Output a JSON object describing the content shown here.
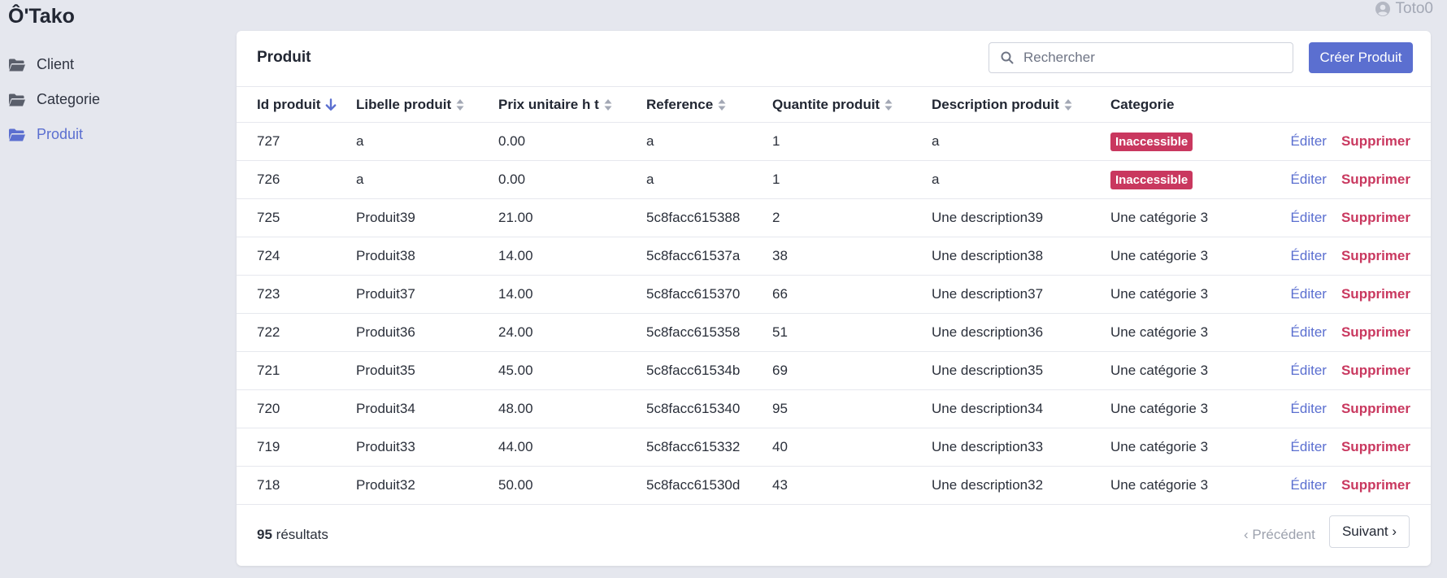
{
  "app": {
    "title": "Ô'Tako",
    "user": "Toto0"
  },
  "sidebar": {
    "items": [
      {
        "label": "Client",
        "icon": "folder-icon",
        "active": false
      },
      {
        "label": "Categorie",
        "icon": "folder-icon",
        "active": false
      },
      {
        "label": "Produit",
        "icon": "folder-open-icon",
        "active": true
      }
    ]
  },
  "panel": {
    "title": "Produit",
    "search": {
      "placeholder": "Rechercher",
      "value": ""
    },
    "create_label": "Créer Produit"
  },
  "table": {
    "columns": [
      {
        "label": "Id produit",
        "sort": "desc"
      },
      {
        "label": "Libelle produit",
        "sort": "none"
      },
      {
        "label": "Prix unitaire h t",
        "sort": "none"
      },
      {
        "label": "Reference",
        "sort": "none"
      },
      {
        "label": "Quantite produit",
        "sort": "none"
      },
      {
        "label": "Description produit",
        "sort": "none"
      },
      {
        "label": "Categorie",
        "sort": null
      }
    ],
    "edit_label": "Éditer",
    "delete_label": "Supprimer",
    "rows": [
      {
        "id": "727",
        "libelle": "a",
        "prix": "0.00",
        "reference": "a",
        "quantite": "1",
        "description": "a",
        "categorie": "Inaccessible",
        "categorie_badge": true
      },
      {
        "id": "726",
        "libelle": "a",
        "prix": "0.00",
        "reference": "a",
        "quantite": "1",
        "description": "a",
        "categorie": "Inaccessible",
        "categorie_badge": true
      },
      {
        "id": "725",
        "libelle": "Produit39",
        "prix": "21.00",
        "reference": "5c8facc615388",
        "quantite": "2",
        "description": "Une description39",
        "categorie": "Une catégorie 3",
        "categorie_badge": false
      },
      {
        "id": "724",
        "libelle": "Produit38",
        "prix": "14.00",
        "reference": "5c8facc61537a",
        "quantite": "38",
        "description": "Une description38",
        "categorie": "Une catégorie 3",
        "categorie_badge": false
      },
      {
        "id": "723",
        "libelle": "Produit37",
        "prix": "14.00",
        "reference": "5c8facc615370",
        "quantite": "66",
        "description": "Une description37",
        "categorie": "Une catégorie 3",
        "categorie_badge": false
      },
      {
        "id": "722",
        "libelle": "Produit36",
        "prix": "24.00",
        "reference": "5c8facc615358",
        "quantite": "51",
        "description": "Une description36",
        "categorie": "Une catégorie 3",
        "categorie_badge": false
      },
      {
        "id": "721",
        "libelle": "Produit35",
        "prix": "45.00",
        "reference": "5c8facc61534b",
        "quantite": "69",
        "description": "Une description35",
        "categorie": "Une catégorie 3",
        "categorie_badge": false
      },
      {
        "id": "720",
        "libelle": "Produit34",
        "prix": "48.00",
        "reference": "5c8facc615340",
        "quantite": "95",
        "description": "Une description34",
        "categorie": "Une catégorie 3",
        "categorie_badge": false
      },
      {
        "id": "719",
        "libelle": "Produit33",
        "prix": "44.00",
        "reference": "5c8facc615332",
        "quantite": "40",
        "description": "Une description33",
        "categorie": "Une catégorie 3",
        "categorie_badge": false
      },
      {
        "id": "718",
        "libelle": "Produit32",
        "prix": "50.00",
        "reference": "5c8facc61530d",
        "quantite": "43",
        "description": "Une description32",
        "categorie": "Une catégorie 3",
        "categorie_badge": false
      }
    ]
  },
  "footer": {
    "count": "95",
    "count_suffix": "résultats",
    "prev_label": "Précédent",
    "next_label": "Suivant"
  },
  "colors": {
    "accent": "#5b6fd0",
    "danger": "#c9385f",
    "background": "#e5e7ee"
  }
}
